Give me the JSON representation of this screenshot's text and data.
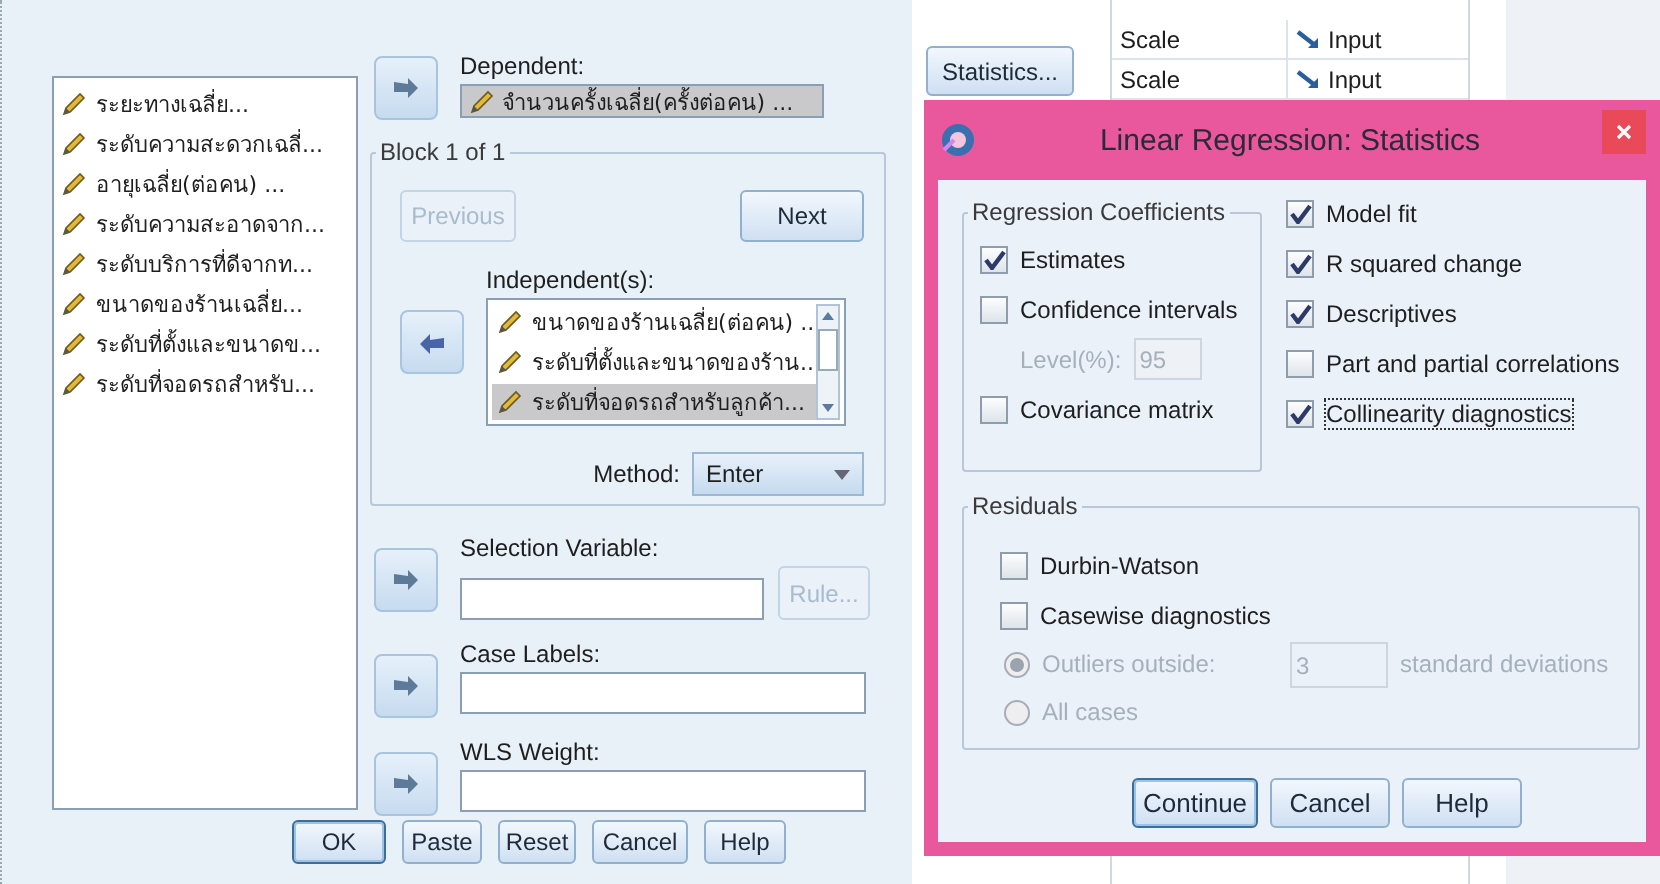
{
  "background_table": {
    "rows": [
      {
        "measure": "Scale",
        "role": "Input"
      },
      {
        "measure": "Scale",
        "role": "Input"
      }
    ]
  },
  "regression_dialog": {
    "variables": [
      "ระยะทางเฉลี่ย...",
      "ระดับความสะดวกเฉลี่...",
      "อายุเฉลี่ย(ต่อคน) ...",
      "ระดับความสะอาดจาก...",
      "ระดับบริการที่ดีจากท...",
      "ขนาดของร้านเฉลี่ย...",
      "ระดับที่ตั้งและขนาดข...",
      "ระดับที่จอดรถสำหรับ..."
    ],
    "dependent": {
      "label": "Dependent:",
      "value": "จำนวนครั้งเฉลี่ย(ครั้งต่อคน) ..."
    },
    "block": {
      "title": "Block 1 of 1",
      "previous": {
        "label": "Previous",
        "disabled": true
      },
      "next": {
        "label": "Next",
        "disabled": false
      }
    },
    "independents": {
      "label": "Independent(s):",
      "items": [
        {
          "text": "ขนาดของร้านเฉลี่ย(ต่อคน) ...",
          "selected": false
        },
        {
          "text": "ระดับที่ตั้งและขนาดของร้าน...",
          "selected": false
        },
        {
          "text": "ระดับที่จอดรถสำหรับลูกค้า...",
          "selected": true
        }
      ]
    },
    "method": {
      "label": "Method:",
      "value": "Enter"
    },
    "selection_variable": {
      "label": "Selection Variable:",
      "rule": {
        "label": "Rule...",
        "disabled": true
      }
    },
    "case_labels": {
      "label": "Case Labels:"
    },
    "wls_weight": {
      "label": "WLS Weight:"
    },
    "statistics_button": "Statistics...",
    "buttons": [
      {
        "label": "OK",
        "default": true
      },
      {
        "label": "Paste",
        "default": false
      },
      {
        "label": "Reset",
        "default": false
      },
      {
        "label": "Cancel",
        "default": false
      },
      {
        "label": "Help",
        "default": false
      }
    ]
  },
  "statistics_dialog": {
    "title": "Linear Regression: Statistics",
    "coefficients": {
      "title": "Regression Coefficients",
      "items": [
        {
          "kind": "checkbox",
          "label": "Estimates",
          "checked": true
        },
        {
          "kind": "checkbox",
          "label": "Confidence intervals",
          "checked": false
        },
        {
          "kind": "level",
          "label": "Level(%):",
          "value": "95",
          "disabled": true
        },
        {
          "kind": "checkbox",
          "label": "Covariance matrix",
          "checked": false
        }
      ]
    },
    "options": [
      {
        "label": "Model fit",
        "checked": true,
        "focused": false
      },
      {
        "label": "R squared change",
        "checked": true,
        "focused": false
      },
      {
        "label": "Descriptives",
        "checked": true,
        "focused": false
      },
      {
        "label": "Part and partial correlations",
        "checked": false,
        "focused": false
      },
      {
        "label": "Collinearity diagnostics",
        "checked": true,
        "focused": true
      }
    ],
    "residuals": {
      "title": "Residuals",
      "items": [
        {
          "kind": "checkbox",
          "label": "Durbin-Watson",
          "checked": false
        },
        {
          "kind": "checkbox",
          "label": "Casewise diagnostics",
          "checked": false
        },
        {
          "kind": "radio",
          "label": "Outliers outside:",
          "selected": true,
          "disabled": true,
          "value": "3",
          "suffix": "standard deviations"
        },
        {
          "kind": "radio",
          "label": "All cases",
          "selected": false,
          "disabled": true
        }
      ]
    },
    "buttons": [
      {
        "label": "Continue",
        "default": true
      },
      {
        "label": "Cancel",
        "default": false
      },
      {
        "label": "Help",
        "default": false
      }
    ]
  }
}
